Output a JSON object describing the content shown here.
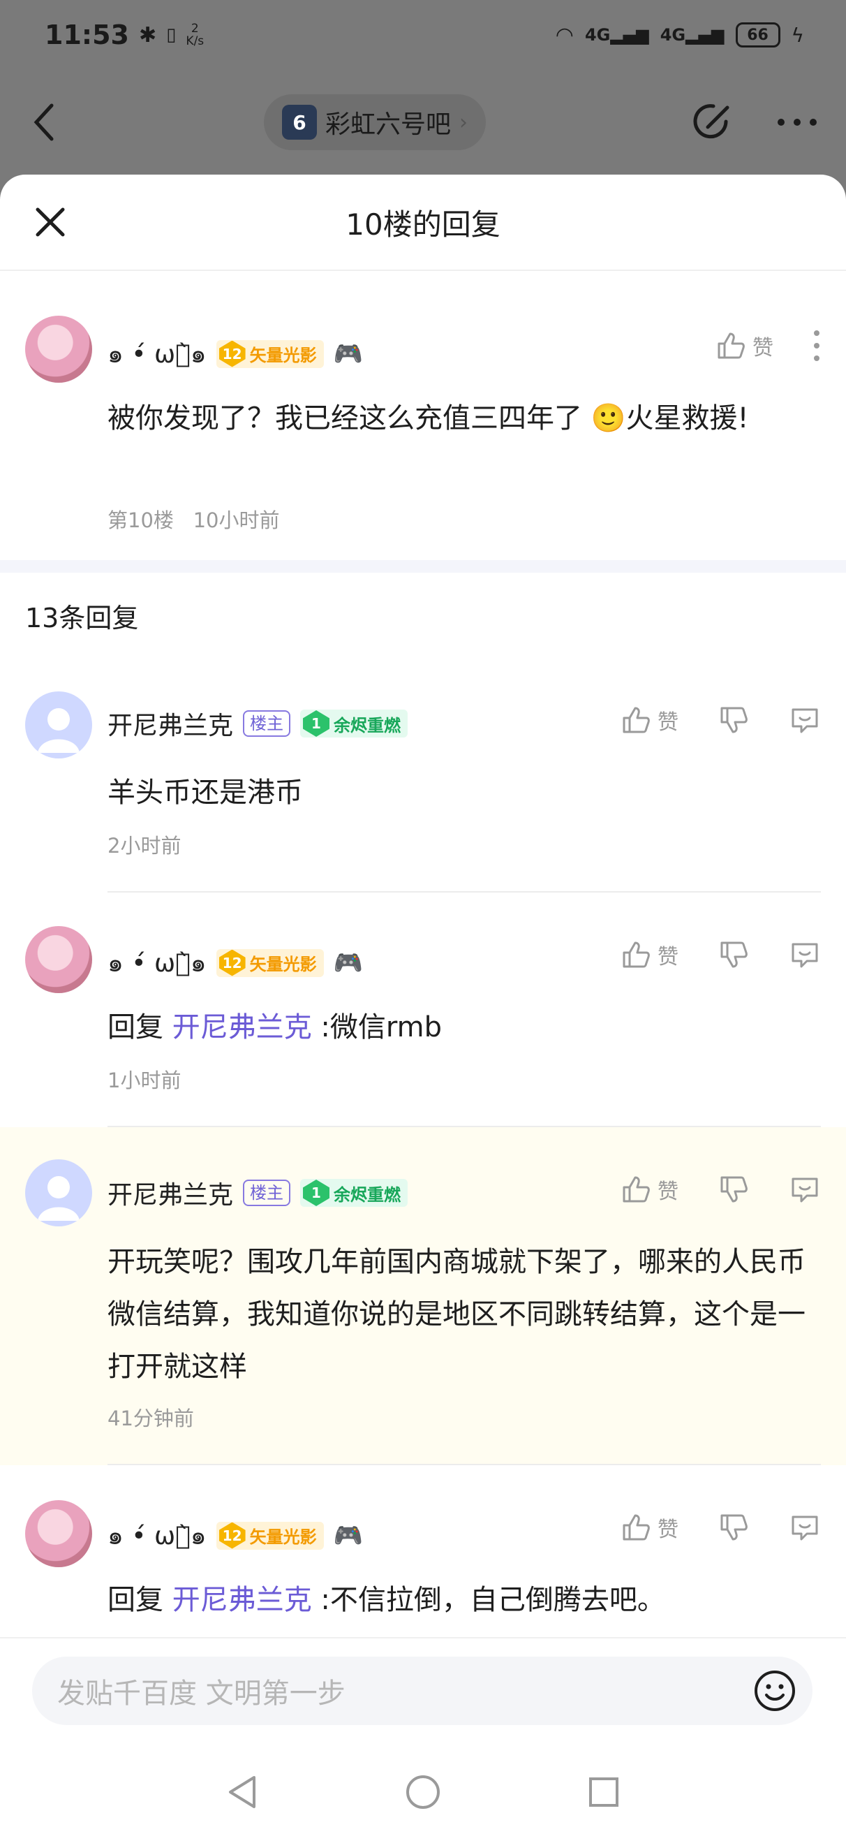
{
  "status": {
    "time": "11:53",
    "net_speed_top": "2",
    "net_speed_unit": "K/s",
    "battery": "66"
  },
  "forum": {
    "name": "彩虹六号吧",
    "logo_letter": "6"
  },
  "sheet": {
    "title": "10楼的回复"
  },
  "main_post": {
    "username": "๑ •́ ωก̀๑",
    "level": "12",
    "level_title": "矢量光影",
    "content": "被你发现了？我已经这么充值三四年了 🙂火星救援!",
    "floor": "第10楼",
    "time": "10小时前",
    "like_label": "赞"
  },
  "replies_header": "13条回复",
  "replies": [
    {
      "username": "开尼弗兰克",
      "host_badge": "楼主",
      "level": "1",
      "level_title": "余烬重燃",
      "reply_to_prefix": "",
      "reply_to_name": "",
      "content": "羊头币还是港币",
      "time": "2小时前",
      "like_label": "赞"
    },
    {
      "username": "๑ •́ ωก̀๑",
      "level": "12",
      "level_title": "矢量光影",
      "reply_to_prefix": "回复 ",
      "reply_to_name": "开尼弗兰克",
      "content": " :微信rmb",
      "time": "1小时前",
      "like_label": "赞"
    },
    {
      "username": "开尼弗兰克",
      "host_badge": "楼主",
      "level": "1",
      "level_title": "余烬重燃",
      "reply_to_prefix": "",
      "reply_to_name": "",
      "content": "开玩笑呢？围攻几年前国内商城就下架了，哪来的人民币微信结算，我知道你说的是地区不同跳转结算，这个是一打开就这样",
      "time": "41分钟前",
      "like_label": "赞"
    },
    {
      "username": "๑ •́ ωก̀๑",
      "level": "12",
      "level_title": "矢量光影",
      "reply_to_prefix": "回复 ",
      "reply_to_name": "开尼弗兰克",
      "content": " :不信拉倒，自己倒腾去吧。",
      "like_label": "赞"
    }
  ],
  "input": {
    "placeholder": "发贴千百度 文明第一步"
  },
  "colors": {
    "accent_purple": "#6b5bd6",
    "highlight_row": "#fffdf1",
    "level_gold": "#f7b500",
    "level_green": "#2bc26b"
  }
}
